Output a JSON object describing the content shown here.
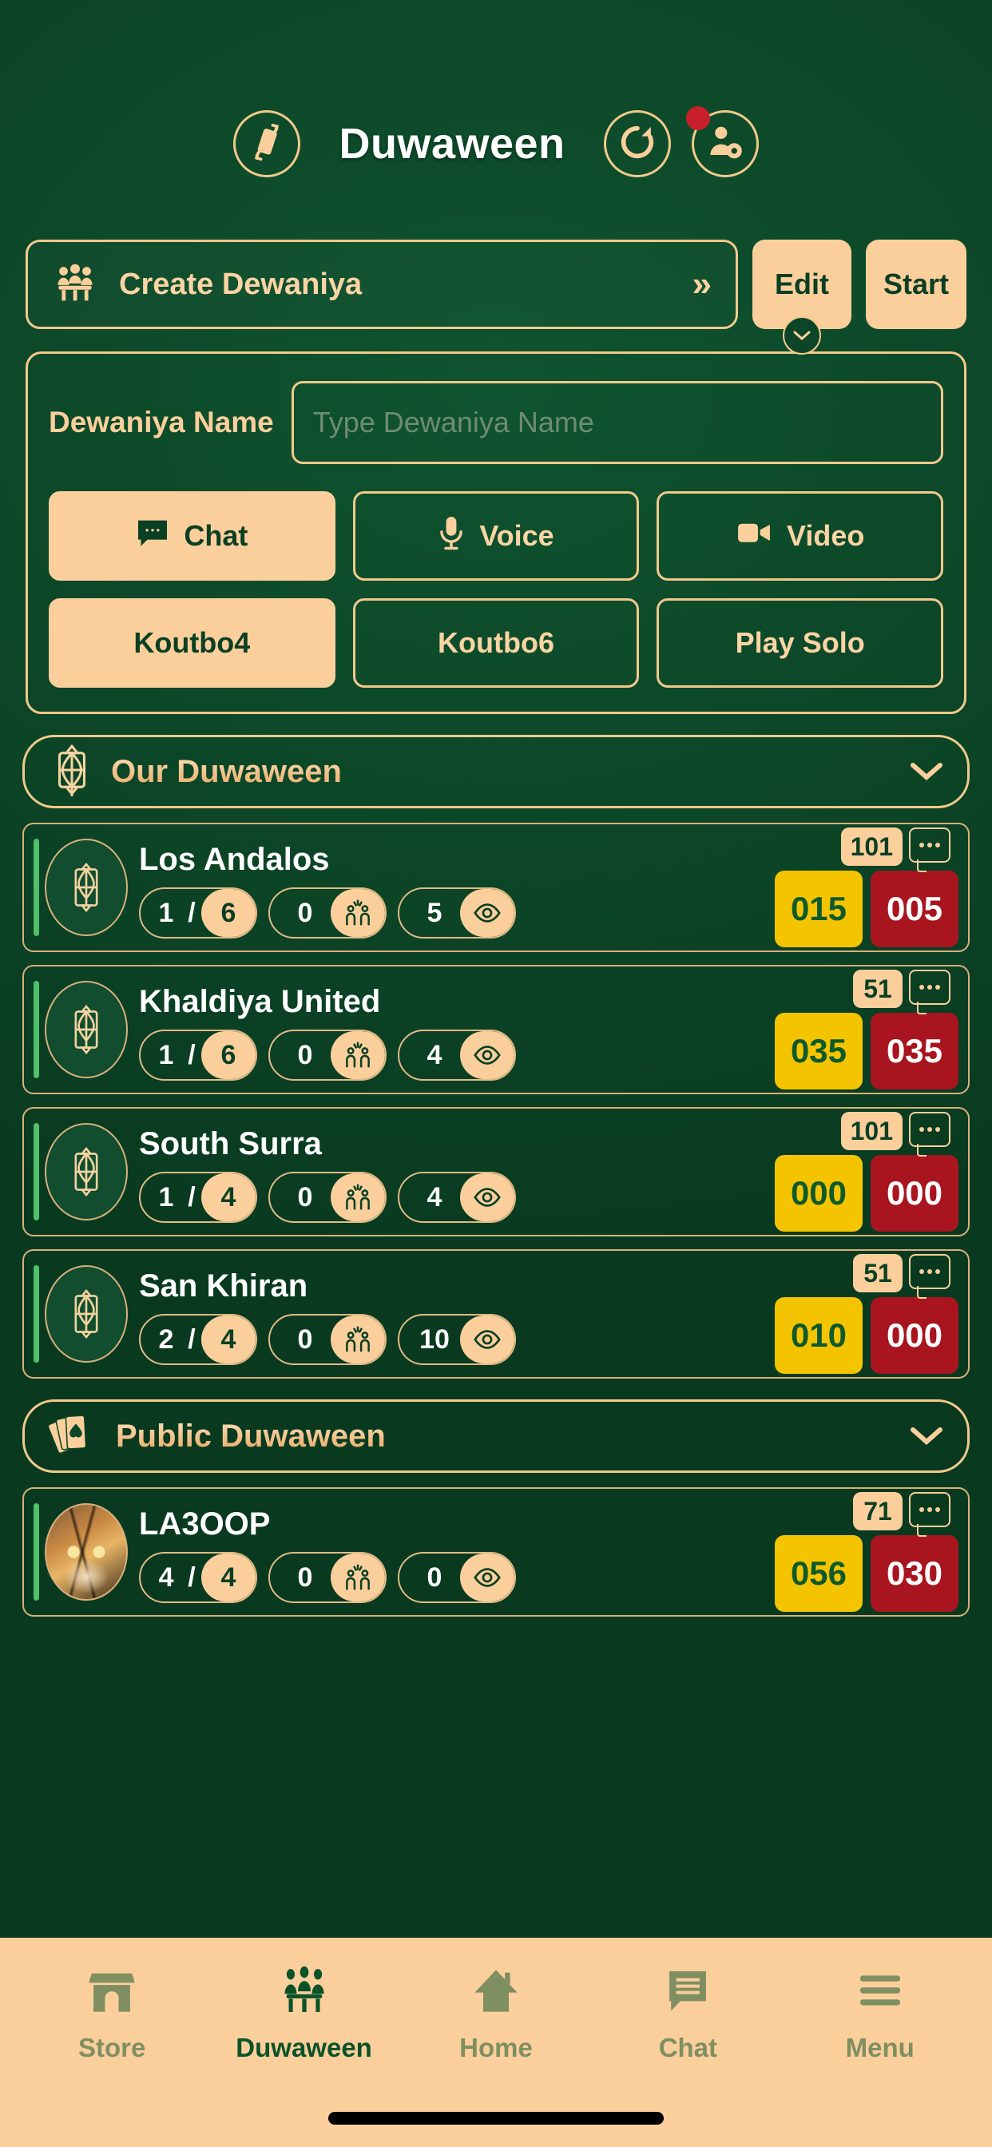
{
  "header": {
    "title": "Duwaween",
    "rotate_icon": "rotate-device-icon",
    "refresh_icon": "refresh-icon",
    "profile_icon": "profile-settings-icon",
    "has_notification": true,
    "notification_color": "#c8202a"
  },
  "actions": {
    "create_label": "Create Dewaniya",
    "create_icon": "people-table-icon",
    "chevron": "»",
    "edit_label": "Edit",
    "start_label": "Start",
    "edit_caret": "⌄"
  },
  "form": {
    "name_label": "Dewaniya Name",
    "name_value": "",
    "name_placeholder": "Type Dewaniya Name",
    "mode_options": [
      {
        "label": "Chat",
        "icon": "chat-bubble-icon",
        "active": true
      },
      {
        "label": "Voice",
        "icon": "microphone-icon",
        "active": false
      },
      {
        "label": "Video",
        "icon": "video-camera-icon",
        "active": false
      }
    ],
    "game_options": [
      {
        "label": "Koutbo4",
        "active": true
      },
      {
        "label": "Koutbo6",
        "active": false
      },
      {
        "label": "Play Solo",
        "active": false
      }
    ]
  },
  "sections": [
    {
      "title": "Our Duwaween",
      "icon": "ornament-emblem-icon",
      "chevron": "⌄",
      "rooms": [
        {
          "name": "Los Andalos",
          "avatar": "emblem",
          "round": "1",
          "round_sep": "/",
          "round_total": "6",
          "spectators_waiting": "0",
          "watchers": "5",
          "limit": "101",
          "score_gold": "015",
          "score_red": "005"
        },
        {
          "name": "Khaldiya United",
          "avatar": "emblem",
          "round": "1",
          "round_sep": "/",
          "round_total": "6",
          "spectators_waiting": "0",
          "watchers": "4",
          "limit": "51",
          "score_gold": "035",
          "score_red": "035"
        },
        {
          "name": "South Surra",
          "avatar": "emblem",
          "round": "1",
          "round_sep": "/",
          "round_total": "4",
          "spectators_waiting": "0",
          "watchers": "4",
          "limit": "101",
          "score_gold": "000",
          "score_red": "000"
        },
        {
          "name": "San Khiran",
          "avatar": "emblem",
          "round": "2",
          "round_sep": "/",
          "round_total": "4",
          "spectators_waiting": "0",
          "watchers": "10",
          "limit": "51",
          "score_gold": "010",
          "score_red": "000"
        }
      ]
    },
    {
      "title": "Public Duwaween",
      "icon": "playing-cards-icon",
      "chevron": "⌄",
      "rooms": [
        {
          "name": "LA3OOP",
          "avatar": "tiger-photo",
          "round": "4",
          "round_sep": "/",
          "round_total": "4",
          "spectators_waiting": "0",
          "watchers": "0",
          "limit": "71",
          "score_gold": "056",
          "score_red": "030"
        }
      ]
    }
  ],
  "bottom_nav": [
    {
      "label": "Store",
      "icon": "store-icon",
      "active": false
    },
    {
      "label": "Duwaween",
      "icon": "people-table-icon",
      "active": true
    },
    {
      "label": "Home",
      "icon": "home-icon",
      "active": false
    },
    {
      "label": "Chat",
      "icon": "chat-lines-icon",
      "active": false
    },
    {
      "label": "Menu",
      "icon": "hamburger-menu-icon",
      "active": false
    }
  ],
  "theme": {
    "background_green": "#0c4527",
    "accent_cream": "#fbcf9b",
    "gold_border": "#f2c98a",
    "score_gold_bg": "#f5c400",
    "score_red_bg": "#a8151f",
    "online_bar": "#4ec16a"
  }
}
